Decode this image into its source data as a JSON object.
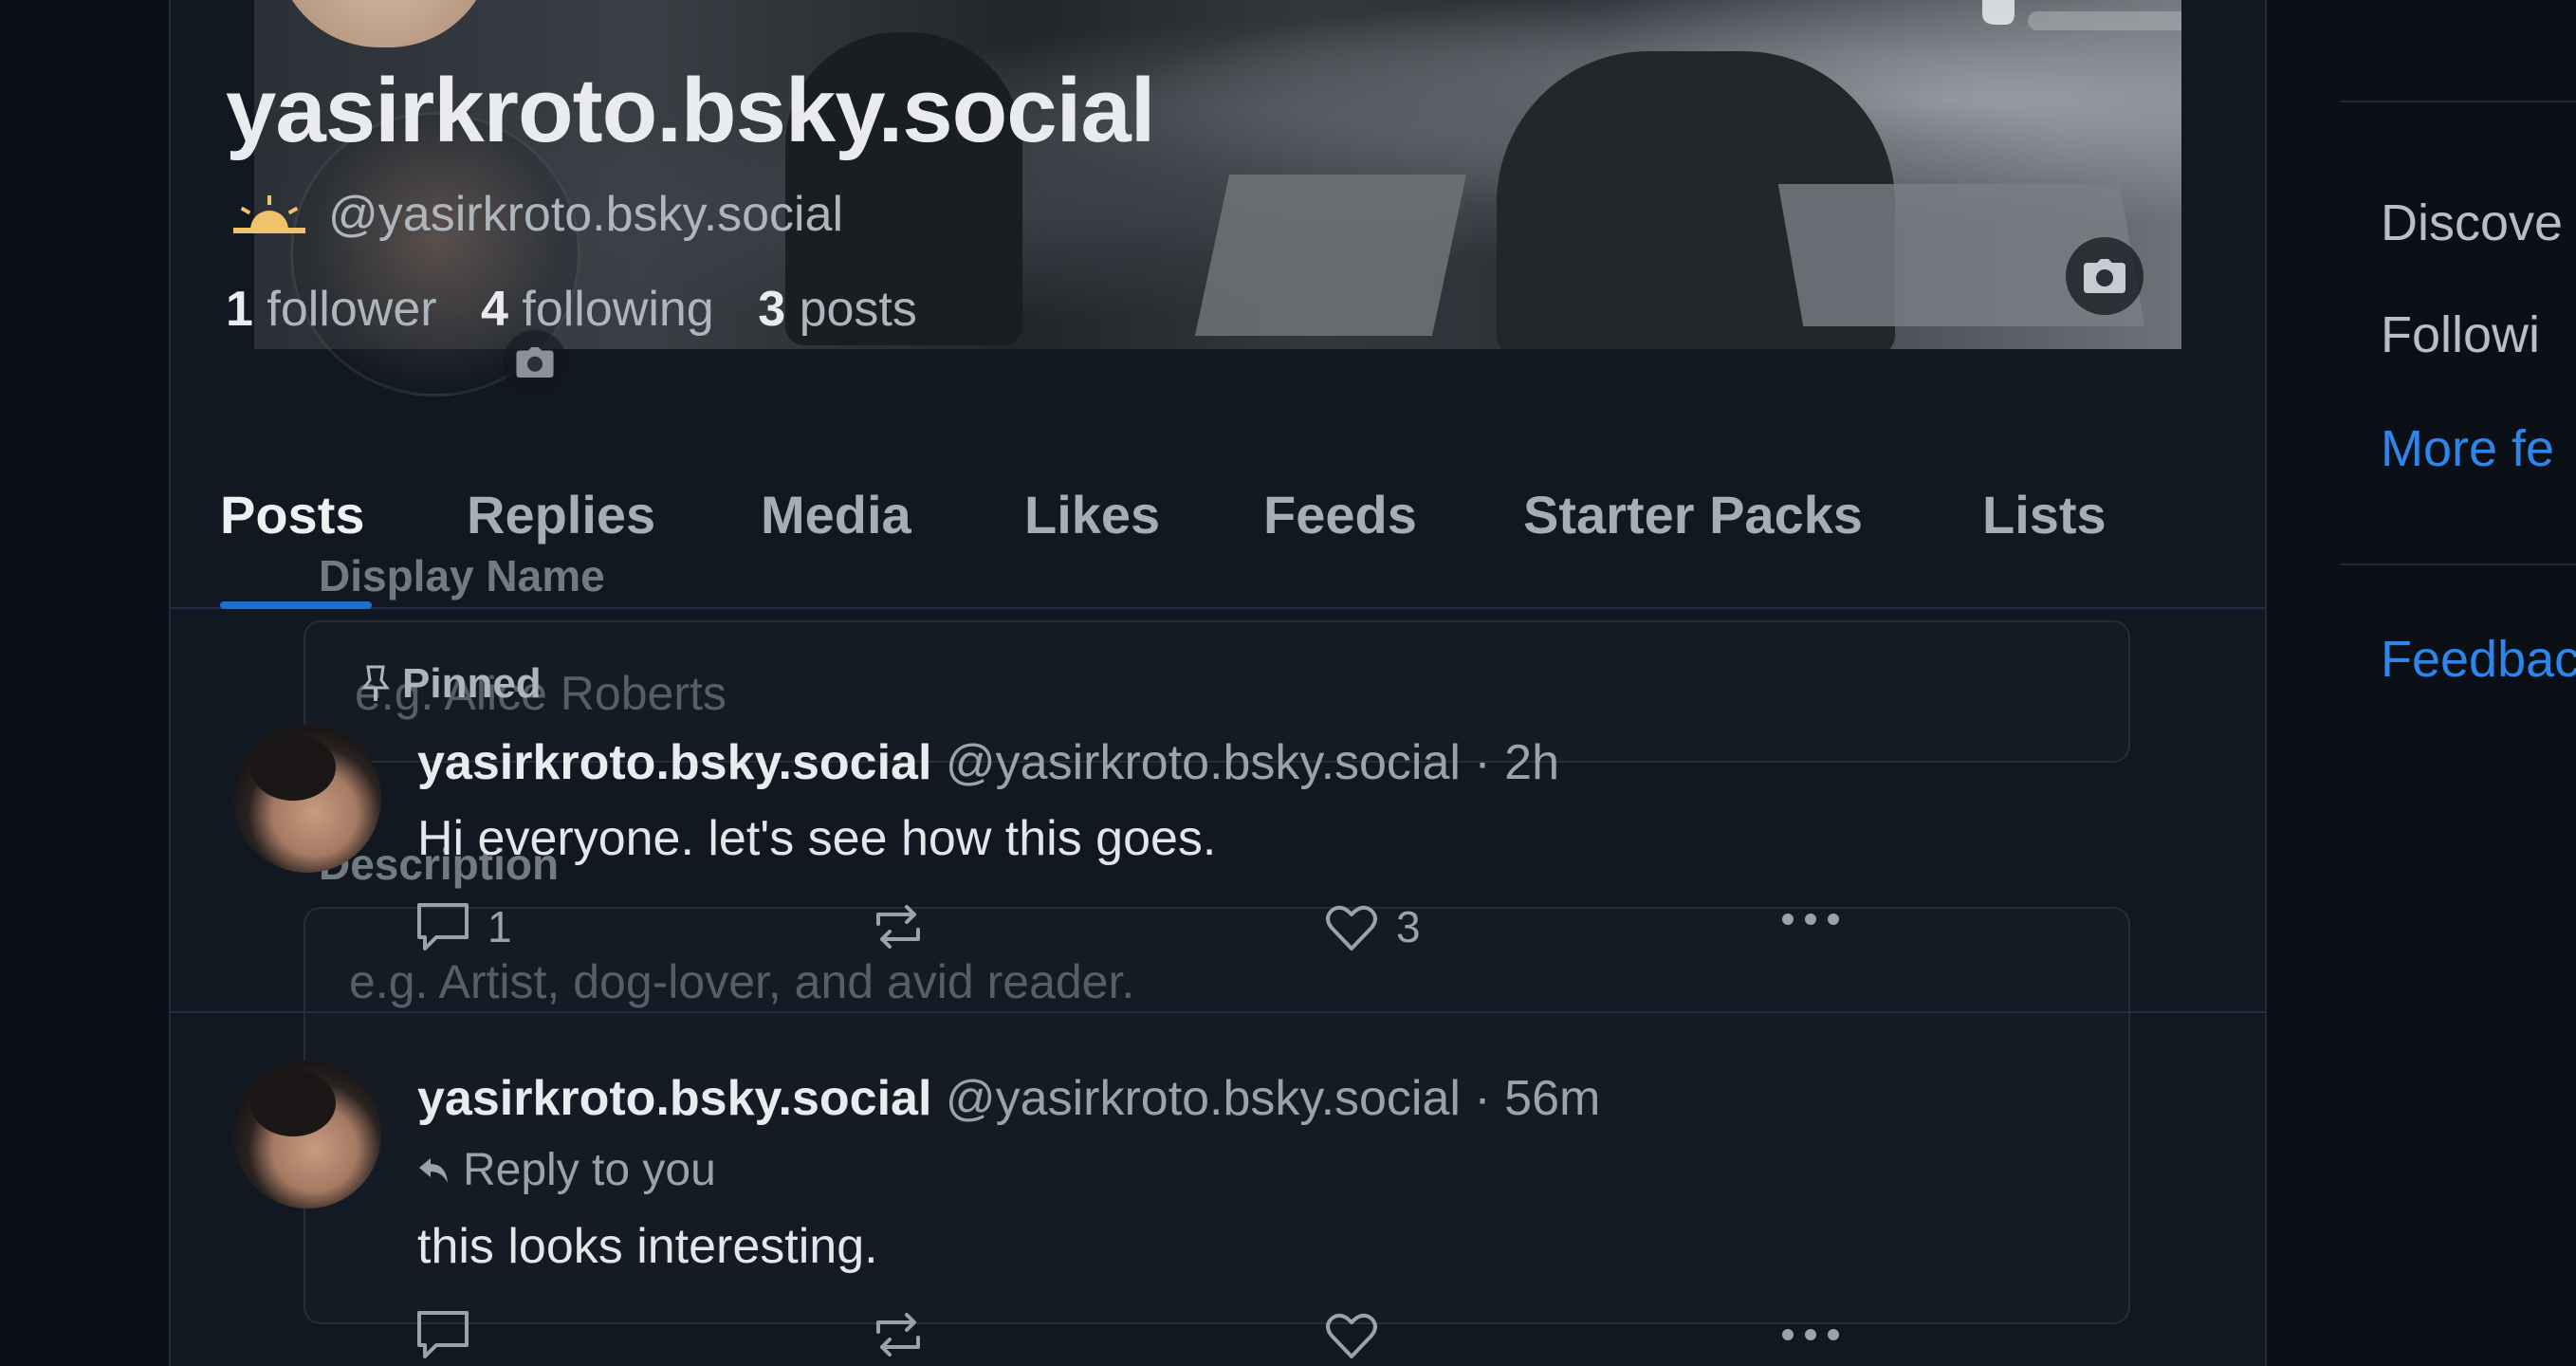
{
  "profile": {
    "display_name": "yasirkroto.bsky.social",
    "handle": "@yasirkroto.bsky.social",
    "followers_count": "1",
    "followers_label": "follower",
    "following_count": "4",
    "following_label": "following",
    "posts_count": "3",
    "posts_label": "posts"
  },
  "tabs": [
    "Posts",
    "Replies",
    "Media",
    "Likes",
    "Feeds",
    "Starter Packs",
    "Lists"
  ],
  "edit_form": {
    "display_name_label": "Display Name",
    "display_name_placeholder": "e.g. Alice Roberts",
    "description_label": "Description",
    "description_placeholder": "e.g. Artist, dog-lover, and avid reader."
  },
  "pinned_label": "Pinned",
  "posts": [
    {
      "name": "yasirkroto.bsky.social",
      "meta": "@yasirkroto.bsky.social · 2h",
      "text": "Hi everyone. let's see how this goes.",
      "replies": "1",
      "likes": "3"
    },
    {
      "name": "yasirkroto.bsky.social",
      "meta": "@yasirkroto.bsky.social · 56m",
      "reply_to": "Reply to you",
      "text": "this looks interesting."
    }
  ],
  "right_sidebar": {
    "items": [
      "Discove",
      "Followi"
    ],
    "more_feeds": "More fe",
    "feedback": "Feedbac"
  },
  "colors": {
    "accent": "#1f6fd1",
    "link": "#2f86ea",
    "background": "#111821"
  }
}
